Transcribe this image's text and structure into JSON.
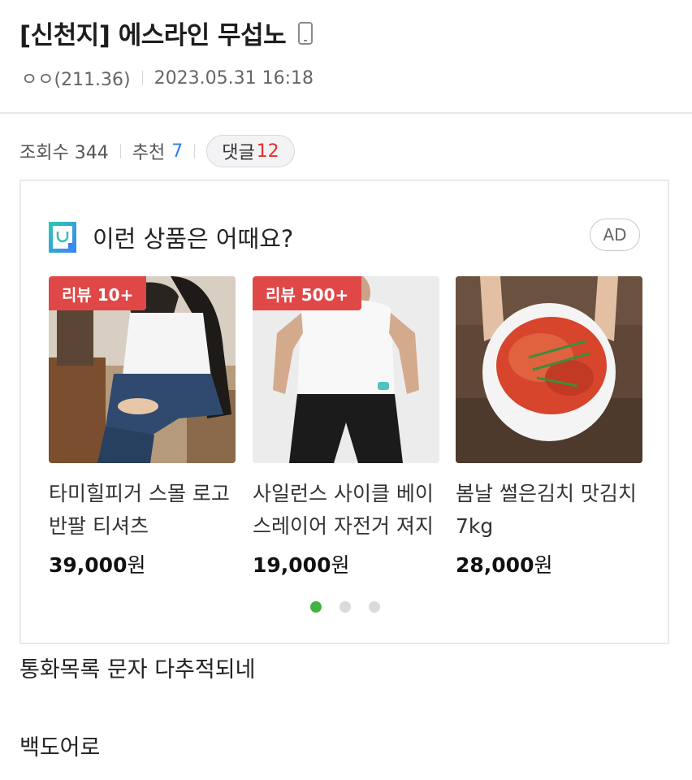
{
  "post": {
    "title": "[신천지] 에스라인 무섭노",
    "author": "ㅇㅇ(211.36)",
    "date": "2023.05.31 16:18",
    "views_label": "조회수 344",
    "recommend_label": "추천",
    "recommend_count": "7",
    "comment_label": "댓글",
    "comment_count": "12",
    "body_line1": "통화목록 문자 다추적되네",
    "body_line2": "백도어로"
  },
  "ad": {
    "heading": "이런 상품은 어때요?",
    "badge": "AD",
    "products": [
      {
        "review": "리뷰 10+",
        "name": "타미힐피거 스몰 로고 반팔 티셔츠",
        "price": "39,000",
        "unit": "원"
      },
      {
        "review": "리뷰 500+",
        "name": "사일런스 사이클 베이스레이어 자전거 져지",
        "price": "19,000",
        "unit": "원"
      },
      {
        "review": "",
        "name": "봄날 썰은김치 맛김치 7kg",
        "price": "28,000",
        "unit": "원"
      }
    ],
    "pagination": {
      "current": 1,
      "total": 3
    }
  },
  "colors": {
    "accent_blue": "#2f80ed",
    "accent_red": "#e0302f",
    "review_badge": "#e04848",
    "active_dot": "#3fb440"
  },
  "icons": {
    "title": "mobile-phone-icon",
    "ad_heading": "shopping-bag-icon"
  }
}
